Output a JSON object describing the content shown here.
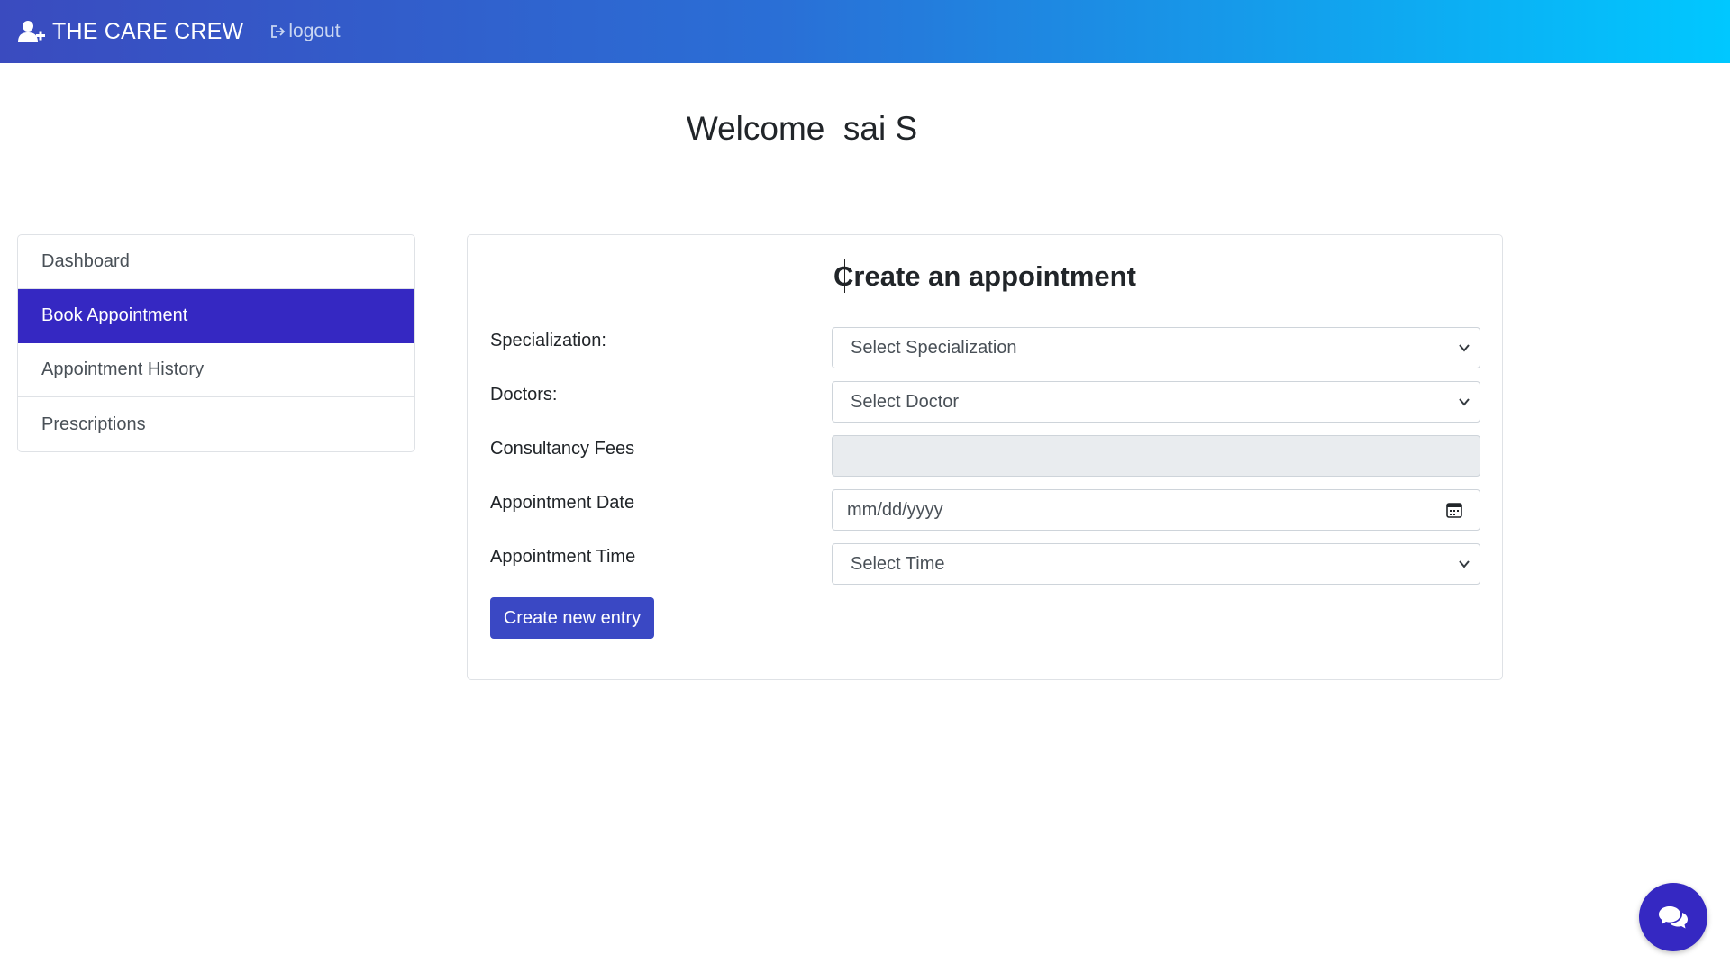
{
  "navbar": {
    "brand": "THE CARE CREW",
    "brand_icon": "user-plus-icon",
    "logout_label": "logout",
    "logout_icon": "sign-out-icon"
  },
  "welcome": {
    "text": "Welcome  sai S"
  },
  "sidebar": {
    "items": [
      {
        "label": "Dashboard",
        "active": false
      },
      {
        "label": "Book Appointment",
        "active": true
      },
      {
        "label": "Appointment History",
        "active": false
      },
      {
        "label": "Prescriptions",
        "active": false
      }
    ]
  },
  "form": {
    "title": "Create an appointment",
    "specialization": {
      "label": "Specialization:",
      "value": "Select Specialization"
    },
    "doctors": {
      "label": "Doctors:",
      "value": "Select Doctor"
    },
    "fees": {
      "label": "Consultancy Fees",
      "value": ""
    },
    "date": {
      "label": "Appointment Date",
      "placeholder": "mm/dd/yyyy"
    },
    "time": {
      "label": "Appointment Time",
      "value": "Select Time"
    },
    "submit_label": "Create new entry"
  },
  "chat": {
    "icon": "chat-bubbles-icon"
  },
  "colors": {
    "navbar_gradient_start": "#3a4bbf",
    "navbar_gradient_end": "#00c8ff",
    "active_item": "#3528c2",
    "button": "#3a48c4"
  }
}
